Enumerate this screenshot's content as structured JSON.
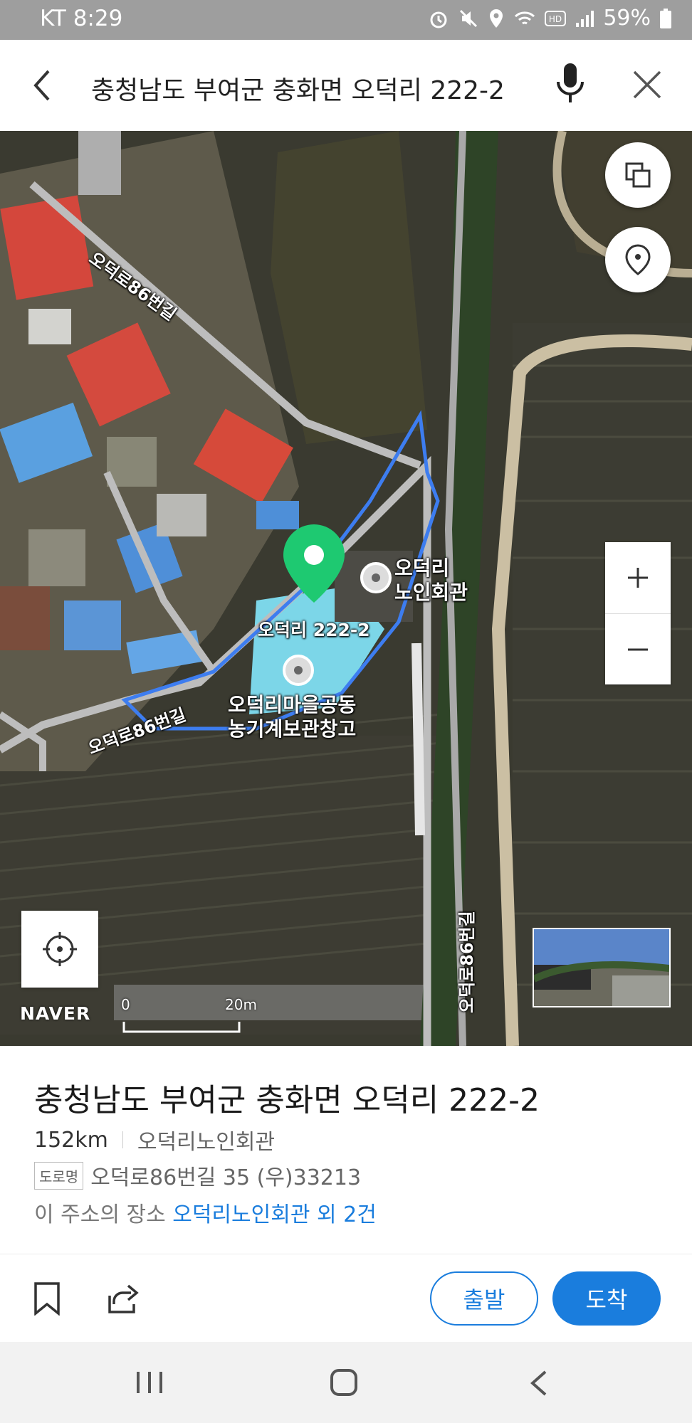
{
  "status_bar": {
    "carrier_time": "KT 8:29",
    "battery": "59%",
    "icons": [
      "alarm-icon",
      "mute-icon",
      "location-icon",
      "wifi-icon",
      "hd-icon",
      "signal-icon",
      "battery-icon"
    ]
  },
  "search": {
    "query": "충청남도 부여군 충화면 오덕리 222-2"
  },
  "map": {
    "pin_label": "오덕리 222-2",
    "poi_1_line1": "오덕리",
    "poi_1_line2": "노인회관",
    "poi_2_line1": "오덕리마을공동",
    "poi_2_line2": "농기계보관창고",
    "road_label_1": "오덕로86번길",
    "road_label_2": "오덕로86번길",
    "road_label_3": "오덕로86번길",
    "logo": "NAVER",
    "scale_start": "0",
    "scale_end": "20m",
    "colors": {
      "pin": "#1ec971",
      "boundary": "#3d7df0",
      "accent": "#1a7ddd"
    }
  },
  "info": {
    "title": "충청남도 부여군 충화면 오덕리 222-2",
    "distance": "152km",
    "nearby_place": "오덕리노인회관",
    "road_badge": "도로명",
    "road_address": "오덕로86번길 35 (우)33213",
    "places_prefix": "이 주소의 장소",
    "places_link": "오덕리노인회관 외 2건"
  },
  "actions": {
    "depart": "출발",
    "arrive": "도착"
  }
}
